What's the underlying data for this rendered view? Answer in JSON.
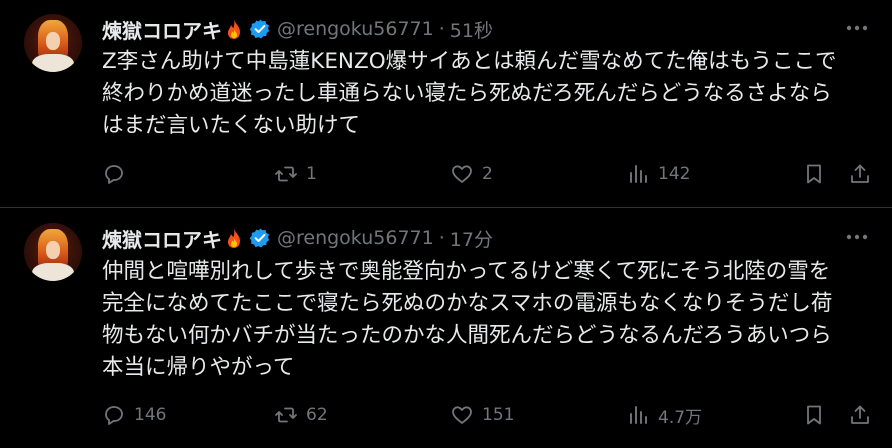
{
  "tweets": [
    {
      "display_name": "煉獄コロアキ",
      "handle": "@rengoku56771",
      "separator": "·",
      "time": "51秒",
      "text": "Z李さん助けて中島蓮KENZO爆サイあとは頼んだ雪なめてた俺はもうここで\n終わりかめ道迷ったし車通らない寝たら死ぬだろ死んだらどうなるさよなら\nはまだ言いたくない助けて",
      "replies": "",
      "retweets": "1",
      "likes": "2",
      "views": "142"
    },
    {
      "display_name": "煉獄コロアキ",
      "handle": "@rengoku56771",
      "separator": "·",
      "time": "17分",
      "text": "仲間と喧嘩別れして歩きで奥能登向かってるけど寒くて死にそう北陸の雪を\n完全になめてたここで寝たら死ぬのかなスマホの電源もなくなりそうだし荷\n物もない何かバチが当たったのかな人間死んだらどうなるんだろうあいつら\n本当に帰りやがって",
      "replies": "146",
      "retweets": "62",
      "likes": "151",
      "views": "4.7万"
    }
  ],
  "colors": {
    "background": "#000000",
    "text": "#e7e9ea",
    "muted": "#71767b",
    "verified": "#1d9bf0",
    "divider": "#2f3336"
  },
  "icons": [
    "avatar",
    "fire-icon",
    "verified-icon",
    "more-icon",
    "reply-icon",
    "retweet-icon",
    "like-icon",
    "views-icon",
    "bookmark-icon",
    "share-icon"
  ]
}
